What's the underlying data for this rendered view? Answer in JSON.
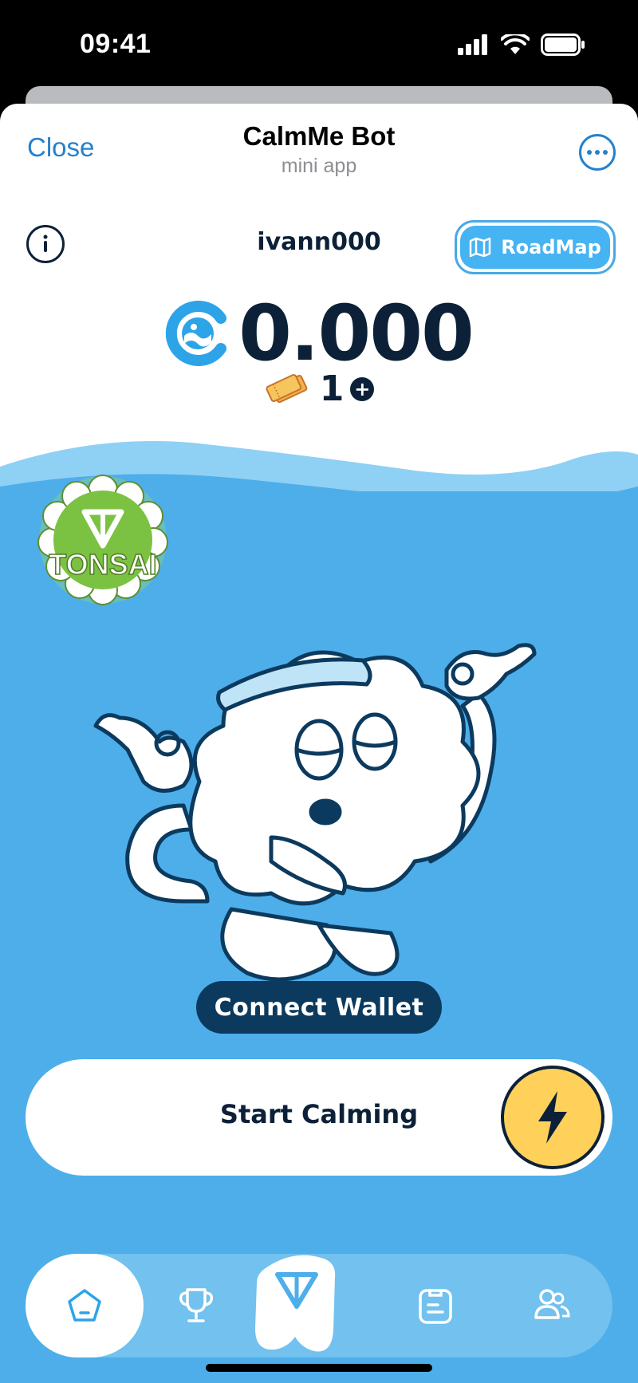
{
  "status_bar": {
    "time": "09:41"
  },
  "telegram_header": {
    "close_label": "Close",
    "title": "CalmMe Bot",
    "subtitle": "mini app",
    "more_icon": "more-icon"
  },
  "app": {
    "username": "ivann000",
    "roadmap_label": "RoadMap",
    "balance": "0.000",
    "tickets": "1",
    "tickets_add": "+",
    "badge_text": "TONSAI",
    "connect_wallet_label": "Connect Wallet",
    "start_label": "Start Calming"
  },
  "bottom_nav": {
    "items": [
      {
        "name": "home",
        "icon": "home-icon",
        "active": true
      },
      {
        "name": "leaderboard",
        "icon": "trophy-icon",
        "active": false
      },
      {
        "name": "ton",
        "icon": "ton-logo-icon",
        "active": false
      },
      {
        "name": "tasks",
        "icon": "tasks-icon",
        "active": false
      },
      {
        "name": "friends",
        "icon": "friends-icon",
        "active": false
      }
    ]
  },
  "colors": {
    "accent_blue": "#2481cc",
    "sky_blue": "#4daeea",
    "navy": "#0c2138",
    "bolt_yellow": "#ffd15a",
    "badge_green": "#7cc242"
  }
}
